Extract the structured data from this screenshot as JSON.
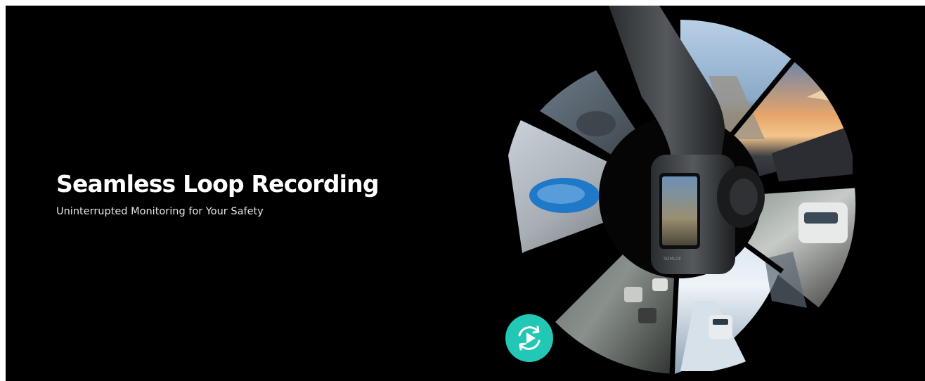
{
  "hero": {
    "title": "Seamless Loop Recording",
    "subtitle": "Uninterrupted Monitoring for Your Safety",
    "background_color": "#000000",
    "accent_color": "#22c7b5"
  },
  "graphic": {
    "description_icon": "dash-camera-with-clip-wheel",
    "clips": [
      {
        "scene": "road-pov",
        "icon": "road-clip-icon"
      },
      {
        "scene": "sunset-highway",
        "icon": "sunset-clip-icon"
      },
      {
        "scene": "suv-on-road",
        "icon": "suv-clip-icon"
      },
      {
        "scene": "snowy-road",
        "icon": "snow-clip-icon"
      },
      {
        "scene": "traffic-jam",
        "icon": "traffic-clip-icon"
      },
      {
        "scene": "blue-car",
        "icon": "blue-car-clip-icon"
      },
      {
        "scene": "car-interior",
        "icon": "interior-clip-icon"
      }
    ],
    "loop_button_icon": "loop-play-icon"
  }
}
